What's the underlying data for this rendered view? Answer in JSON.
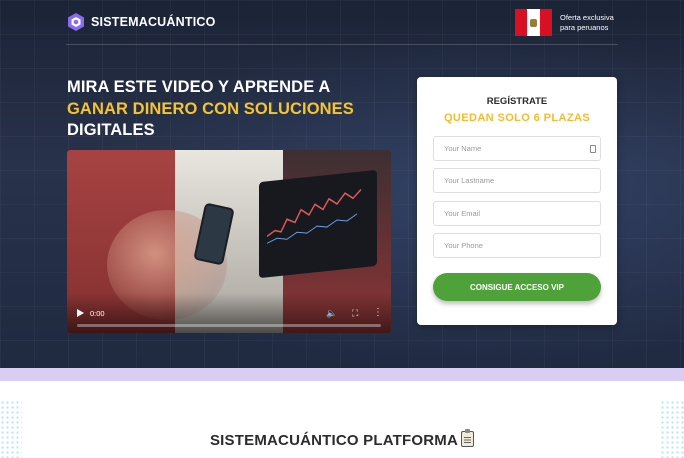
{
  "header": {
    "brand": "SISTEMACUÁNTICO",
    "offer_line1": "Oferta exclusiva",
    "offer_line2": "para peruanos",
    "colors": {
      "flag_red": "#d91023",
      "accent_yellow": "#f5c431",
      "cta_green": "#4fa23a"
    }
  },
  "hero": {
    "headline_line1": "MIRA ESTE VIDEO Y APRENDE A",
    "headline_highlight": "GANAR DINERO CON SOLUCIONES",
    "headline_line3": "DIGITALES"
  },
  "video": {
    "time": "0:00",
    "progress": 0
  },
  "form": {
    "title": "REGÍSTRATE",
    "subtitle": "QUEDAN SOLO 6 PLAZAS",
    "fields": {
      "name": {
        "placeholder": "Your Name",
        "value": ""
      },
      "lastname": {
        "placeholder": "Your Lastname",
        "value": ""
      },
      "email": {
        "placeholder": "Your Email",
        "value": ""
      },
      "phone": {
        "placeholder": "Your Phone",
        "value": ""
      }
    },
    "submit_label": "CONSIGUE ACCESO VIP"
  },
  "platform": {
    "title": "SISTEMACUÁNTICO PLATFORMA",
    "icon": "clipboard-icon"
  }
}
